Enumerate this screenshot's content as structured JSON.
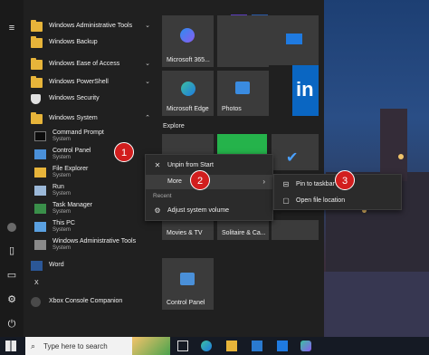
{
  "app_list": [
    {
      "type": "folder",
      "label": "Windows Administrative Tools",
      "expanded": false
    },
    {
      "type": "folder",
      "label": "Windows Backup"
    },
    {
      "type": "folder",
      "label": "Windows Ease of Access",
      "expanded": false
    },
    {
      "type": "folder",
      "label": "Windows PowerShell",
      "expanded": false
    },
    {
      "type": "app",
      "label": "Windows Security"
    },
    {
      "type": "folder",
      "label": "Windows System",
      "expanded": true
    }
  ],
  "system_apps": [
    {
      "label": "Command Prompt",
      "sub": "System"
    },
    {
      "label": "Control Panel",
      "sub": "System"
    },
    {
      "label": "File Explorer",
      "sub": "System"
    },
    {
      "label": "Run",
      "sub": "System"
    },
    {
      "label": "Task Manager",
      "sub": "System"
    },
    {
      "label": "This PC",
      "sub": "System"
    },
    {
      "label": "Windows Administrative Tools",
      "sub": "System"
    }
  ],
  "letter_x": "X",
  "bottom_apps": [
    {
      "label": "Word"
    },
    {
      "label": "Xbox Console Companion"
    }
  ],
  "tiles": {
    "microsoft365": "Microsoft 365...",
    "edge": "Microsoft Edge",
    "photos": "Photos",
    "explore_label": "Explore",
    "movies": "Movies & TV",
    "solitaire": "Solitaire & Ca...",
    "control_panel": "Control Panel"
  },
  "context_menu": {
    "unpin": "Unpin from Start",
    "more": "More",
    "recent_label": "Recent",
    "recent_item": "Adjust system volume"
  },
  "submenu": {
    "pin_taskbar": "Pin to taskbar",
    "open_location": "Open file location"
  },
  "steps": [
    "1",
    "2",
    "3"
  ],
  "taskbar": {
    "search_placeholder": "Type here to search"
  },
  "colors": {
    "start_bg": "#202020",
    "tile_bg": "#3b3b3b",
    "accent_blue": "#0078d4",
    "linkedin_blue": "#0a66c2",
    "step_red": "#d21e1e",
    "folder_yellow": "#e7b43a"
  }
}
